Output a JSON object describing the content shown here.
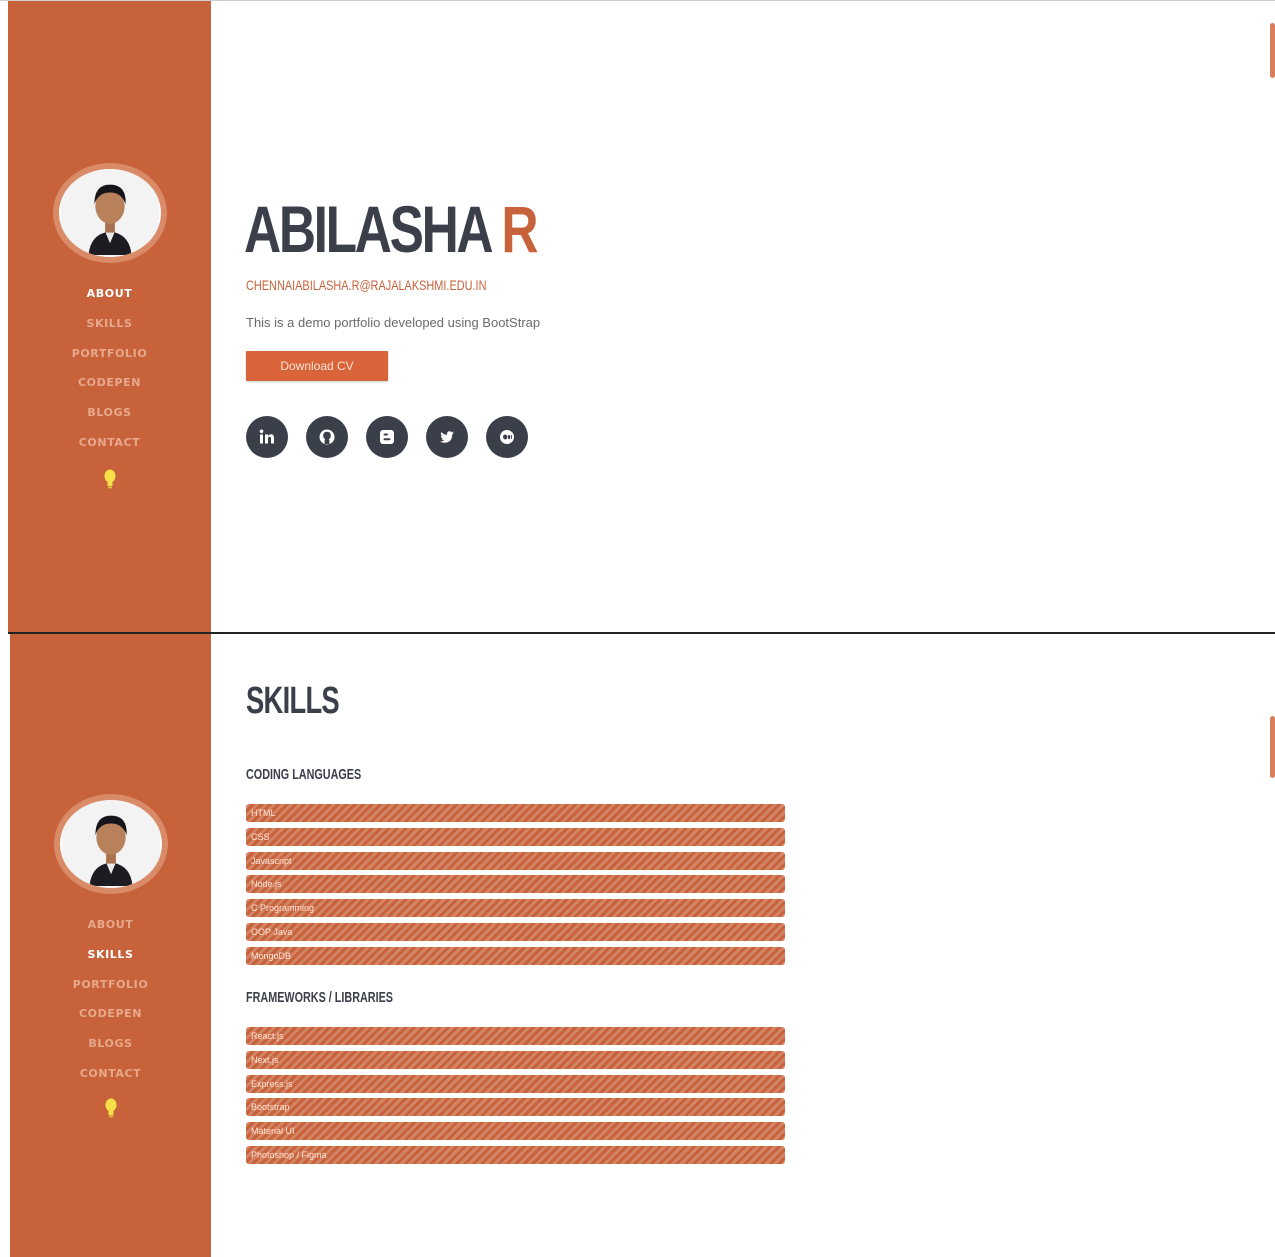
{
  "profile": {
    "first_name": "ABILASHA",
    "last_name": "R",
    "email": "CHENNAIABILASHA.R@RAJALAKSHMI.EDU.IN",
    "intro": "This is a demo portfolio developed using BootStrap",
    "cv_button": "Download CV",
    "socials": [
      "linkedin-icon",
      "github-icon",
      "blogger-icon",
      "twitter-icon",
      "medium-icon"
    ]
  },
  "nav": {
    "items": [
      "ABOUT",
      "SKILLS",
      "PORTFOLIO",
      "CODEPEN",
      "BLOGS",
      "CONTACT"
    ],
    "active_top": "ABOUT",
    "active_bottom": "SKILLS",
    "icon": "lightbulb-icon"
  },
  "skills": {
    "title": "SKILLS",
    "coding_title": "CODING LANGUAGES",
    "coding": [
      "HTML",
      "CSS",
      "Javascript",
      "Node.js",
      "C Programming",
      "OOP Java",
      "MongoDB"
    ],
    "frameworks_title": "FRAMEWORKS / LIBRARIES",
    "frameworks": [
      "React.js",
      "Next.js",
      "Express.js",
      "Bootstrap",
      "Material UI",
      "Photoshop / Figma"
    ]
  },
  "colors": {
    "accent": "#c8623b",
    "dark": "#3a3f4a"
  }
}
